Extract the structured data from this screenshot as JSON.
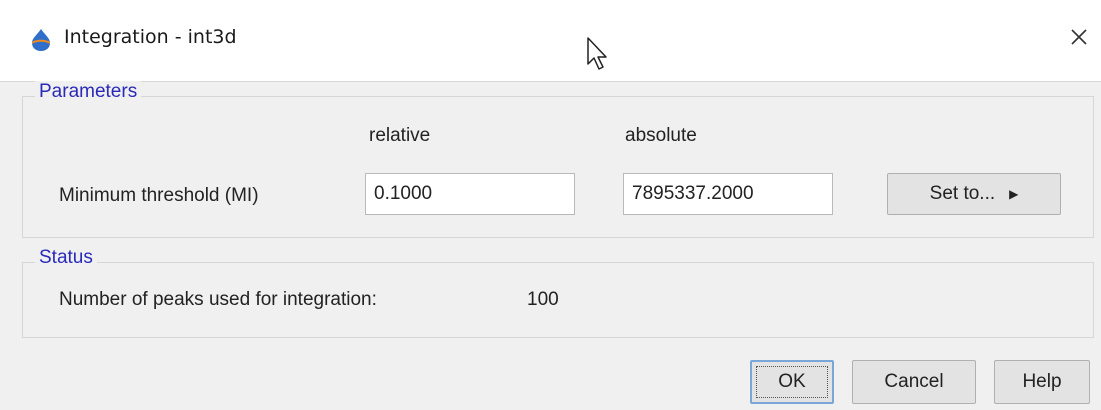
{
  "window": {
    "title": "Integration - int3d",
    "close_glyph": "✕"
  },
  "parameters": {
    "legend": "Parameters",
    "col_relative": "relative",
    "col_absolute": "absolute",
    "row_label": "Minimum threshold (MI)",
    "relative_value": "0.1000",
    "absolute_value": "7895337.2000",
    "set_to_label": "Set to...",
    "set_to_arrow": "▶"
  },
  "status": {
    "legend": "Status",
    "peaks_label": "Number of peaks used for integration:",
    "peaks_value": "100"
  },
  "buttons": {
    "ok": "OK",
    "cancel": "Cancel",
    "help": "Help"
  },
  "colors": {
    "legend_text": "#2a2ab8",
    "dialog_bg": "#f0f0f0",
    "ok_focus_border": "#7aa7d8"
  }
}
